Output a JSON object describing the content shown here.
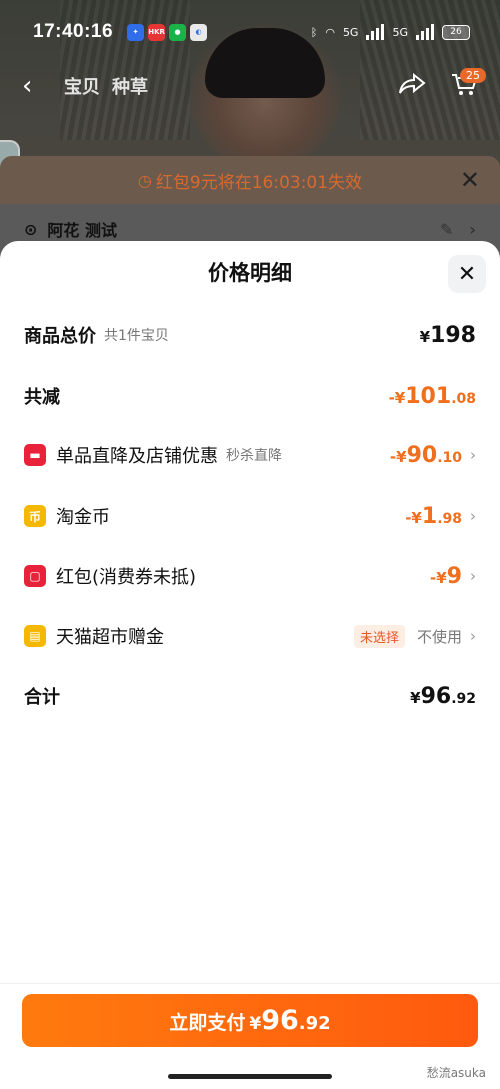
{
  "status_bar": {
    "time": "17:40:16",
    "app_icons": [
      {
        "name": "app-blue",
        "color": "#2f6ee8",
        "text": ""
      },
      {
        "name": "app-red",
        "color": "#e53535",
        "text": "HKR"
      },
      {
        "name": "app-green",
        "color": "#19b34a",
        "text": ""
      },
      {
        "name": "app-white",
        "color": "#e9e9e9",
        "text": ""
      }
    ],
    "signal1": "5G",
    "signal2": "5G",
    "battery": "26"
  },
  "nav": {
    "back": "‹",
    "tabs": [
      "宝贝",
      "种草"
    ],
    "badge": "25"
  },
  "warning": {
    "text": "红包9元将在16:03:01失效"
  },
  "address": {
    "name": "阿花 测试"
  },
  "sheet": {
    "title": "价格明细",
    "rows": {
      "total": {
        "label": "商品总价",
        "sub": "共1件宝贝",
        "cur": "¥",
        "int": "198",
        "dec": ""
      },
      "reduced": {
        "label": "共减",
        "cur": "-¥",
        "int": "101",
        "dec": ".08"
      },
      "shop_discount": {
        "label": "单品直降及店铺优惠",
        "sub": "秒杀直降",
        "cur": "-¥",
        "int": "90",
        "dec": ".10"
      },
      "coins": {
        "label": "淘金币",
        "cur": "-¥",
        "int": "1",
        "dec": ".98"
      },
      "red_packet": {
        "label": "红包(消费券未抵)",
        "cur": "-¥",
        "int": "9",
        "dec": ""
      },
      "tmall_gift": {
        "label": "天猫超市赠金",
        "tag": "未选择",
        "state": "不使用"
      },
      "sum": {
        "label": "合计",
        "cur": "¥",
        "int": "96",
        "dec": ".92"
      }
    }
  },
  "pay": {
    "label": "立即支付",
    "cur": "¥",
    "int": "96",
    "dec": ".92"
  },
  "watermark": "愁流asuka",
  "colors": {
    "accent": "#f06e1c",
    "pay_button": "#ff6a0e",
    "icon_red": "#e8223a",
    "icon_yellow": "#f5b800"
  }
}
